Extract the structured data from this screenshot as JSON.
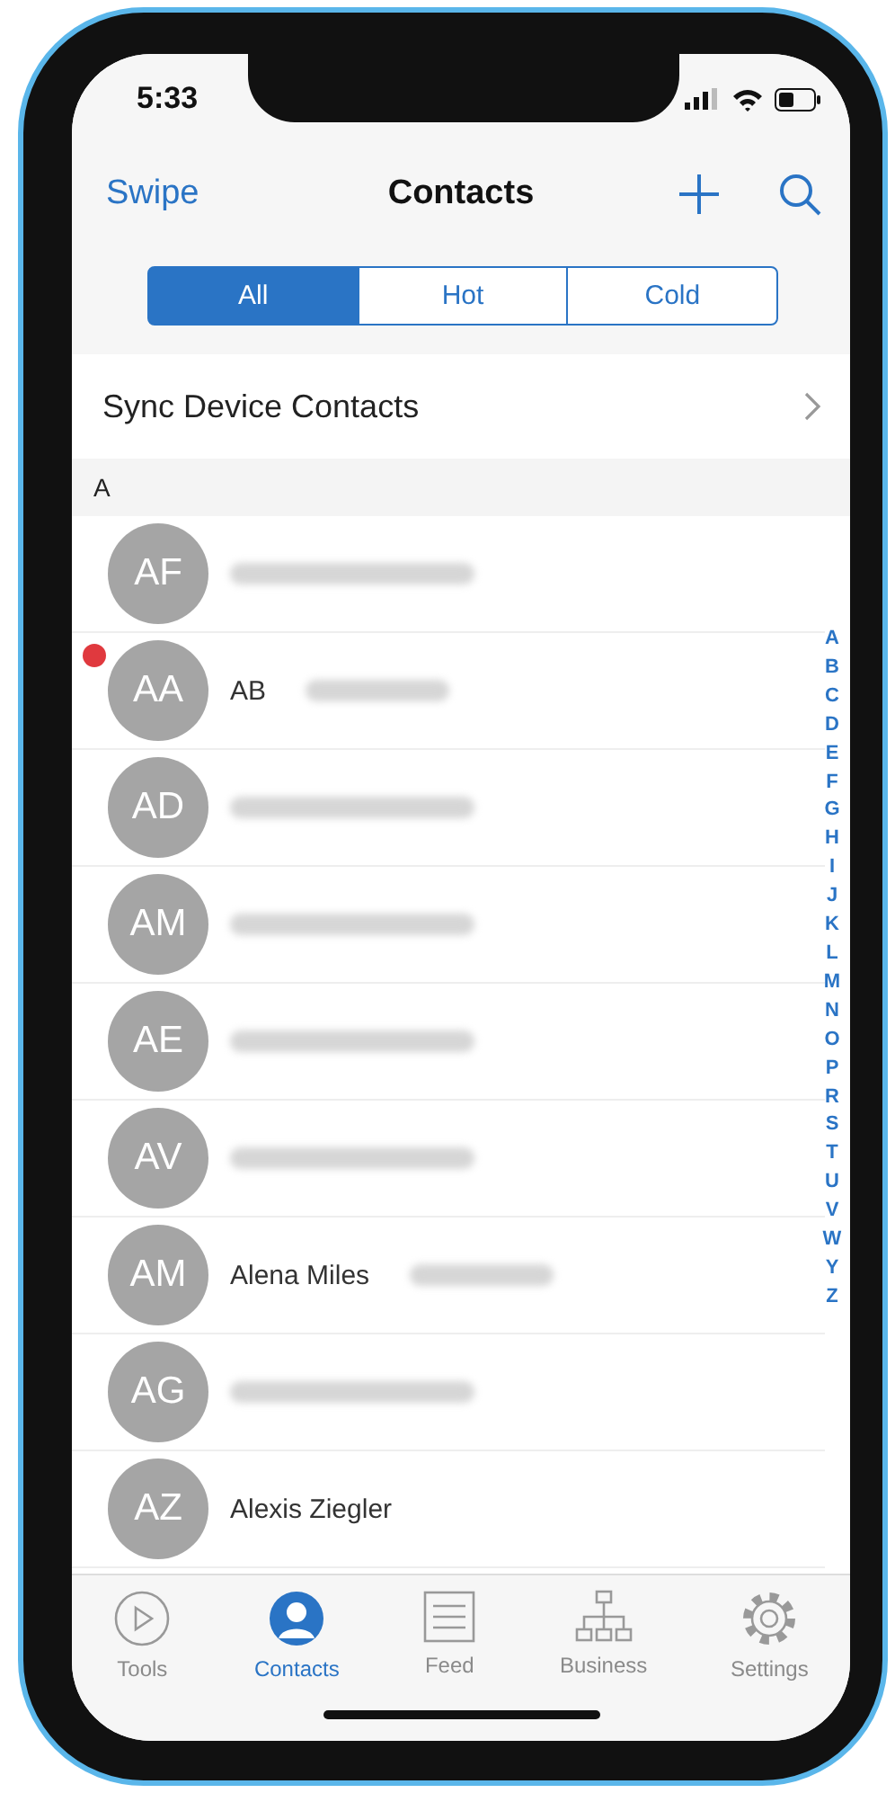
{
  "status_bar": {
    "time": "5:33"
  },
  "nav": {
    "left": "Swipe",
    "title": "Contacts"
  },
  "segments": [
    {
      "label": "All",
      "selected": true
    },
    {
      "label": "Hot",
      "selected": false
    },
    {
      "label": "Cold",
      "selected": false
    }
  ],
  "sync_row": {
    "label": "Sync Device Contacts"
  },
  "section_header": "A",
  "contacts": [
    {
      "initials": "AF",
      "kind": "blurred",
      "unread": false
    },
    {
      "initials": "AA",
      "kind": "partial",
      "name": "AB",
      "unread": true
    },
    {
      "initials": "AD",
      "kind": "blurred",
      "unread": false
    },
    {
      "initials": "AM",
      "kind": "blurred",
      "unread": false
    },
    {
      "initials": "AE",
      "kind": "blurred",
      "unread": false
    },
    {
      "initials": "AV",
      "kind": "blurred",
      "unread": false
    },
    {
      "initials": "AM",
      "kind": "partial",
      "name": "Alena Miles",
      "unread": false
    },
    {
      "initials": "AG",
      "kind": "blurred",
      "unread": false
    },
    {
      "initials": "AZ",
      "kind": "plain",
      "name": "Alexis Ziegler",
      "unread": false
    }
  ],
  "index": [
    "A",
    "B",
    "C",
    "D",
    "E",
    "F",
    "G",
    "H",
    "I",
    "J",
    "K",
    "L",
    "M",
    "N",
    "O",
    "P",
    "R",
    "S",
    "T",
    "U",
    "V",
    "W",
    "Y",
    "Z"
  ],
  "tab_bar": [
    {
      "label": "Tools",
      "kind": "play",
      "selected": false
    },
    {
      "label": "Contacts",
      "kind": "person",
      "selected": true
    },
    {
      "label": "Feed",
      "kind": "feed",
      "selected": false
    },
    {
      "label": "Business",
      "kind": "org",
      "selected": false
    },
    {
      "label": "Settings",
      "kind": "gear",
      "selected": false
    }
  ]
}
